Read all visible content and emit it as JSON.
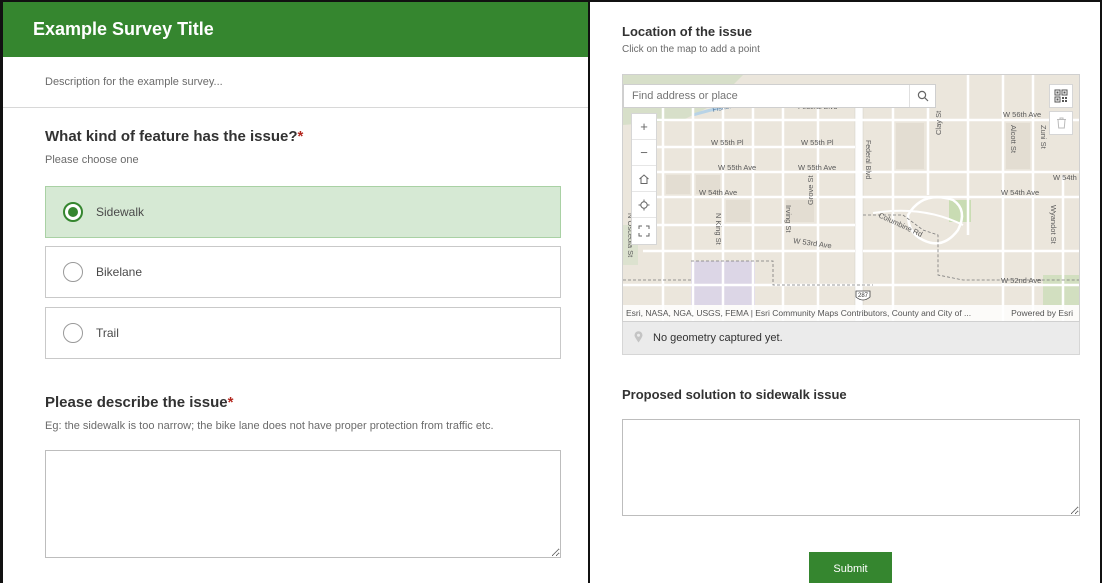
{
  "survey": {
    "title": "Example Survey Title",
    "description": "Description for the example survey..."
  },
  "question_feature": {
    "label": "What kind of feature has the issue?",
    "required_mark": "*",
    "hint": "Please choose one",
    "options": [
      {
        "label": "Sidewalk",
        "selected": true
      },
      {
        "label": "Bikelane",
        "selected": false
      },
      {
        "label": "Trail",
        "selected": false
      }
    ]
  },
  "question_describe": {
    "label": "Please describe the issue",
    "required_mark": "*",
    "hint": "Eg: the sidewalk is too narrow; the bike lane does not have proper protection from traffic etc.",
    "value": ""
  },
  "question_location": {
    "label": "Location of the issue",
    "hint": "Click on the map to add a point",
    "search_placeholder": "Find address or place",
    "attribution": "Esri, NASA, NGA, USGS, FEMA | Esri Community Maps Contributors, County and City of ...",
    "powered_by": "Powered by Esri",
    "geometry_status": "No geometry captured yet.",
    "street_labels": [
      "W 56th Ave",
      "W 55th Pl",
      "W 55th Pl",
      "W 55th Ave",
      "W 55th Ave",
      "W 54th Ave",
      "W 54th Ave",
      "W 54th",
      "W 53rd Ave",
      "W 52nd Ave",
      "Federal Blvd",
      "Clay St",
      "Zuni St",
      "Alcott St",
      "Grove St",
      "Irving St",
      "N King St",
      "N Meade St",
      "N Osceola St",
      "Wyandot St",
      "Columbine Rd",
      "287",
      "Federal Blvd"
    ]
  },
  "question_solution": {
    "label": "Proposed solution to sidewalk issue",
    "value": ""
  },
  "actions": {
    "submit_label": "Submit"
  },
  "colors": {
    "brand_green": "#35862f",
    "selected_bg": "#d6e9d4",
    "required_red": "#b3271e"
  }
}
